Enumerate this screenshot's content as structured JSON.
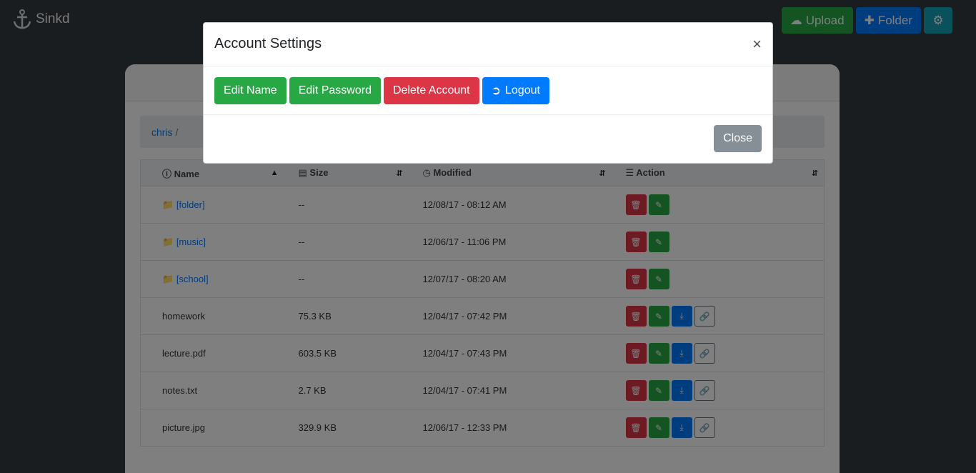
{
  "app": {
    "name": "Sinkd"
  },
  "toolbar": {
    "upload_label": "Upload",
    "folder_label": "Folder"
  },
  "breadcrumb": {
    "user": "chris",
    "separator": "/"
  },
  "table": {
    "headers": [
      "Name",
      "Size",
      "Modified",
      "Action"
    ],
    "rows": [
      {
        "name": "[folder]",
        "size": "--",
        "modified": "12/08/17 - 08:12 AM"
      },
      {
        "name": "[music]",
        "size": "--",
        "modified": "12/06/17 - 11:06 PM"
      },
      {
        "name": "[school]",
        "size": "--",
        "modified": "12/07/17 - 08:20 AM"
      },
      {
        "name": "homework",
        "size": "75.3 KB",
        "modified": "12/04/17 - 07:42 PM"
      },
      {
        "name": "lecture.pdf",
        "size": "603.5 KB",
        "modified": "12/04/17 - 07:43 PM"
      },
      {
        "name": "notes.txt",
        "size": "2.7 KB",
        "modified": "12/04/17 - 07:41 PM"
      },
      {
        "name": "picture.jpg",
        "size": "329.9 KB",
        "modified": "12/06/17 - 12:33 PM"
      }
    ]
  },
  "modal": {
    "title": "Account Settings",
    "close_x": "×",
    "edit_name": "Edit Name",
    "edit_password": "Edit Password",
    "delete_account": "Delete Account",
    "logout": "Logout",
    "close": "Close"
  },
  "colors": {
    "green": "#28a745",
    "blue": "#007bff",
    "red": "#dc3545",
    "teal": "#17a2b8",
    "grey": "#868e96"
  }
}
